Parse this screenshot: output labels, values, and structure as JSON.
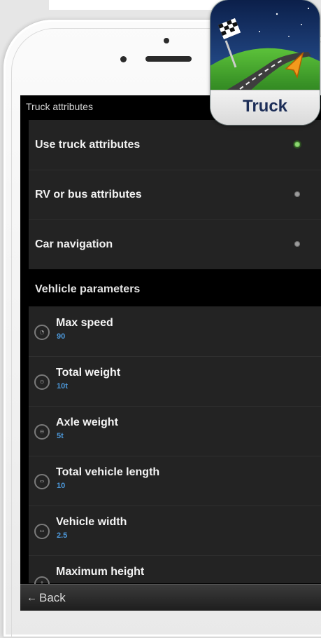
{
  "screen": {
    "title": "Truck attributes"
  },
  "modes": [
    {
      "label": "Use truck attributes",
      "selected": true
    },
    {
      "label": "RV or bus attributes",
      "selected": false
    },
    {
      "label": "Car navigation",
      "selected": false
    }
  ],
  "vehicle_section": {
    "heading": "Vehlicle parameters"
  },
  "parameters": [
    {
      "name": "Max speed",
      "value": "90",
      "icon": "speedometer-icon"
    },
    {
      "name": "Total weight",
      "value": "10t",
      "icon": "weight-icon"
    },
    {
      "name": "Axle weight",
      "value": "5t",
      "icon": "axle-icon"
    },
    {
      "name": "Total vehicle length",
      "value": "10",
      "icon": "length-icon"
    },
    {
      "name": "Vehicle width",
      "value": "2.5",
      "icon": "width-icon"
    },
    {
      "name": "Maximum height",
      "value": "",
      "icon": "height-icon"
    }
  ],
  "footer": {
    "back_label": "Back",
    "back_icon": "back-arrow-icon"
  },
  "app_icon": {
    "label": "Truck"
  },
  "colors": {
    "accent_blue": "#4c97d8",
    "selected_green": "#8ed673",
    "label_navy": "#1c2d57"
  }
}
